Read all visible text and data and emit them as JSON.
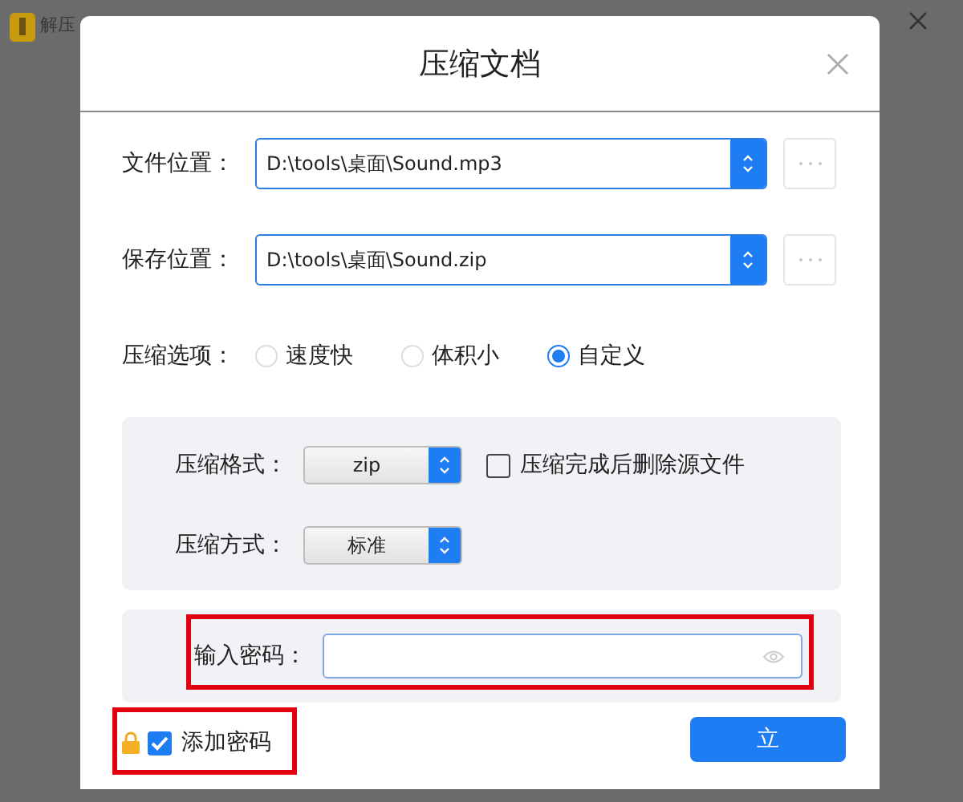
{
  "background_window": {
    "title": "解压"
  },
  "dialog": {
    "title": "压缩文档",
    "paths": [
      {
        "label": "文件位置：",
        "value": "D:\\tools\\桌面\\Sound.mp3"
      },
      {
        "label": "保存位置：",
        "value": "D:\\tools\\桌面\\Sound.zip"
      }
    ],
    "options": {
      "label": "压缩选项：",
      "choices": [
        {
          "label": "速度快",
          "selected": false
        },
        {
          "label": "体积小",
          "selected": false
        },
        {
          "label": "自定义",
          "selected": true
        }
      ]
    },
    "format": {
      "label": "压缩格式：",
      "value": "zip"
    },
    "delete_source": {
      "label": "压缩完成后删除源文件",
      "checked": false
    },
    "method": {
      "label": "压缩方式：",
      "value": "标准"
    },
    "password": {
      "label": "输入密码："
    },
    "add_password": {
      "label": "添加密码",
      "checked": true
    },
    "start_button": "立"
  }
}
